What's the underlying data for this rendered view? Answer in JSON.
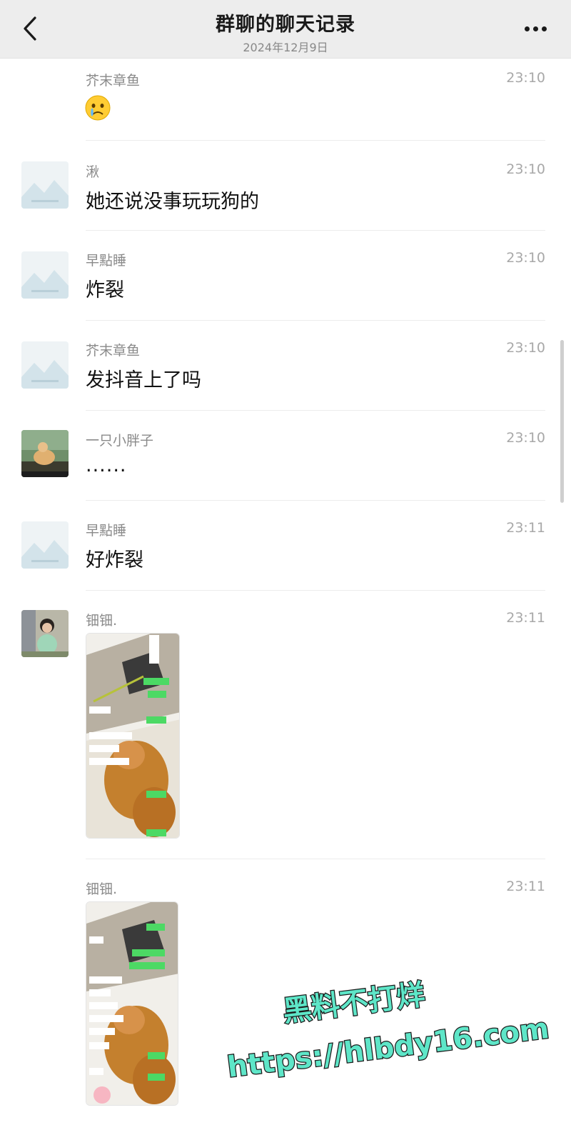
{
  "header": {
    "title": "群聊的聊天记录",
    "date": "2024年12月9日"
  },
  "messages": [
    {
      "sender": "芥末章鱼",
      "time": "23:10",
      "type": "emoji",
      "emoji": "😢",
      "avatar": "none"
    },
    {
      "sender": "湫",
      "time": "23:10",
      "type": "text",
      "text": "她还说没事玩玩狗的",
      "avatar": "placeholder"
    },
    {
      "sender": "早點睡",
      "time": "23:10",
      "type": "text",
      "text": "炸裂",
      "avatar": "placeholder"
    },
    {
      "sender": "芥末章鱼",
      "time": "23:10",
      "type": "text",
      "text": "发抖音上了吗",
      "avatar": "placeholder"
    },
    {
      "sender": "一只小胖子",
      "time": "23:10",
      "type": "text",
      "text": "......",
      "avatar": "photo-cartoon"
    },
    {
      "sender": "早點睡",
      "time": "23:11",
      "type": "text",
      "text": "好炸裂",
      "avatar": "placeholder"
    },
    {
      "sender": "钿钿.",
      "time": "23:11",
      "type": "image",
      "image": "chat-screenshot-dog",
      "avatar": "photo-girl"
    },
    {
      "sender": "钿钿.",
      "time": "23:11",
      "type": "image",
      "image": "chat-screenshot-dog",
      "avatar": "none"
    }
  ],
  "watermark": {
    "line1": "黑料不打烊",
    "line2": "https://hlbdy16.com",
    "color": "#5ee6c8"
  },
  "colors": {
    "header_bg": "#ededed",
    "chat_green": "#4cd964"
  }
}
